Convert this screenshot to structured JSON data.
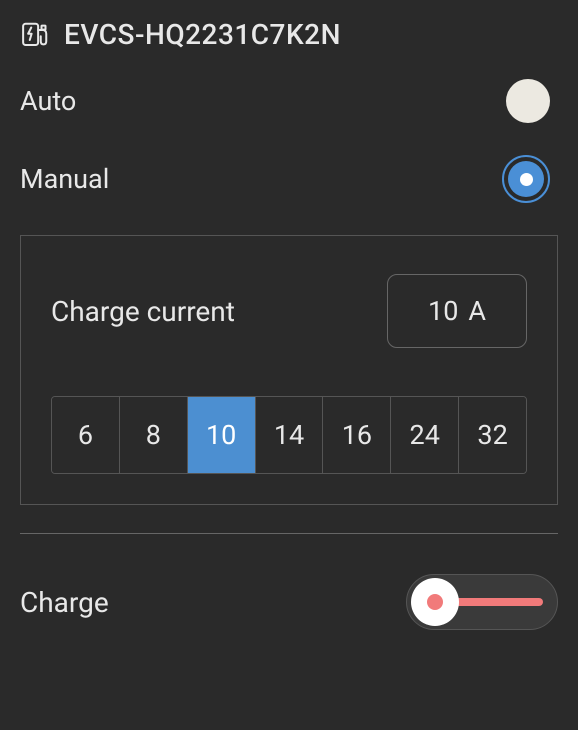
{
  "header": {
    "title": "EVCS-HQ2231C7K2N"
  },
  "modes": {
    "auto": {
      "label": "Auto",
      "selected": false
    },
    "manual": {
      "label": "Manual",
      "selected": true
    }
  },
  "charge_current": {
    "label": "Charge current",
    "value": "10",
    "unit": "A",
    "presets": [
      "6",
      "8",
      "10",
      "14",
      "16",
      "24",
      "32"
    ],
    "selected_preset": "10"
  },
  "charge": {
    "label": "Charge",
    "on": false
  }
}
